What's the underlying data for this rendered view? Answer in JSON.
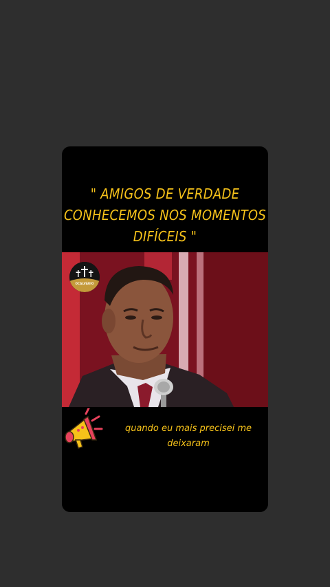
{
  "quote": {
    "line1": "\" AMIGOS DE VERDADE",
    "line2": "CONHECEMOS NOS MOMENTOS",
    "line3": "DIFÍCEIS \""
  },
  "video": {
    "logo_text": "OCALVÁRIO"
  },
  "caption": {
    "line1": "quando eu mais precisei me",
    "line2": "deixaram"
  },
  "icons": {
    "megaphone": "megaphone-icon"
  },
  "colors": {
    "background": "#2e2e2e",
    "card": "#000000",
    "accent_text": "#f6c21a",
    "video_red": "#8c1220"
  }
}
